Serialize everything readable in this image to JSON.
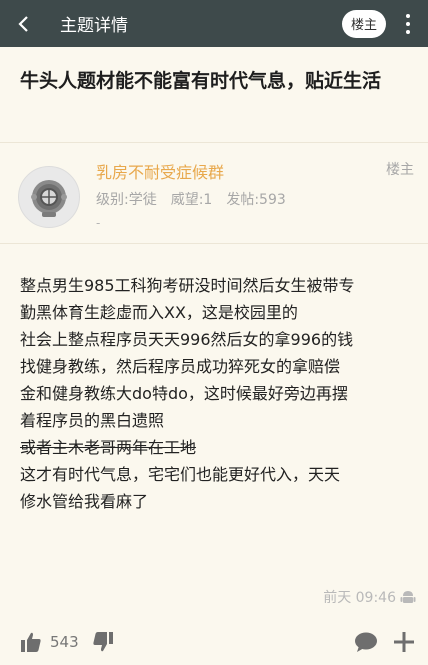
{
  "header": {
    "back_icon": "back-arrow-icon",
    "title": "主题详情",
    "op_badge": "楼主",
    "more_icon": "more-vertical-icon"
  },
  "post": {
    "title": "牛头人题材能不能富有时代气息，贴近生活",
    "author": {
      "name": "乳房不耐受症候群",
      "level": "级别:学徒",
      "prestige": "威望:1",
      "posts": "发帖:593",
      "extra": "-",
      "floor": "楼主"
    },
    "lines": [
      {
        "text": "整点男生985工科狗考研没时间然后女生被带专",
        "strike": false
      },
      {
        "text": "勤黑体育生趁虚而入XX，这是校园里的",
        "strike": false
      },
      {
        "text": "社会上整点程序员天天996然后女的拿996的钱",
        "strike": false
      },
      {
        "text": "找健身教练，然后程序员成功猝死女的拿赔偿",
        "strike": false
      },
      {
        "text": "金和健身教练大do特do，这时候最好旁边再摆",
        "strike": false
      },
      {
        "text": "着程序员的黑白遗照",
        "strike": false
      },
      {
        "text": "或者主木老哥两年在工地",
        "strike": true
      },
      {
        "text": "这才有时代气息，宅宅们也能更好代入，天天",
        "strike": false
      },
      {
        "text": "修水管给我看麻了",
        "strike": false
      }
    ],
    "timestamp": "前天 09:46",
    "device_icon": "android-icon"
  },
  "actions": {
    "like_count": "543",
    "like_icon": "thumbs-up-icon",
    "dislike_icon": "thumbs-down-icon",
    "comment_icon": "comment-icon",
    "add_icon": "plus-icon"
  },
  "colors": {
    "topbar": "#3e4a4b",
    "background": "#fbf8ee",
    "author_name": "#e8a84c",
    "muted": "#a7a7a7"
  }
}
